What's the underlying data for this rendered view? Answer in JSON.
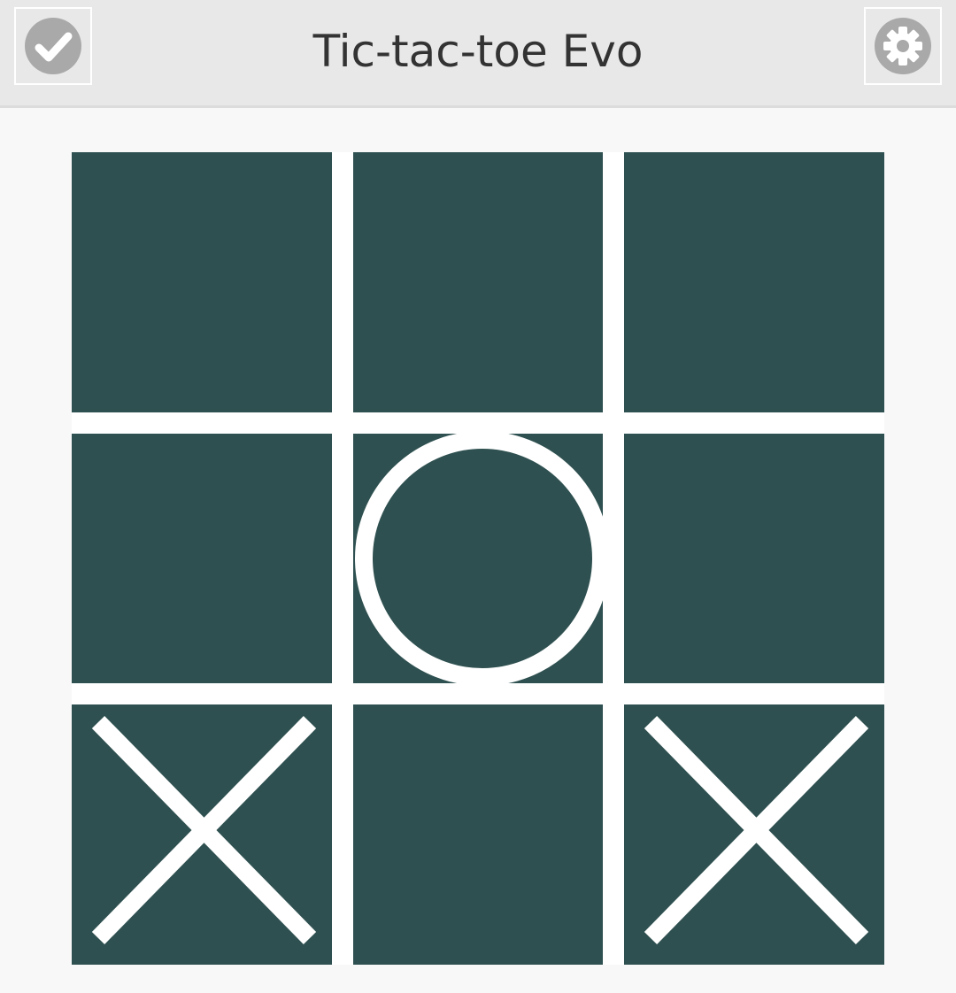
{
  "header": {
    "title": "Tic-tac-toe Evo",
    "left_button_icon": "check-circle-icon",
    "right_button_icon": "gear-icon"
  },
  "colors": {
    "header_bg": "#e8e8e8",
    "page_bg": "#f8f8f8",
    "cell_bg": "#2f5050",
    "mark": "#ffffff",
    "icon": "#a9a9a9",
    "title": "#333333"
  },
  "board": {
    "rows": 3,
    "cols": 3,
    "cells": [
      "",
      "",
      "",
      "",
      "O",
      "",
      "X",
      "",
      "X"
    ]
  }
}
